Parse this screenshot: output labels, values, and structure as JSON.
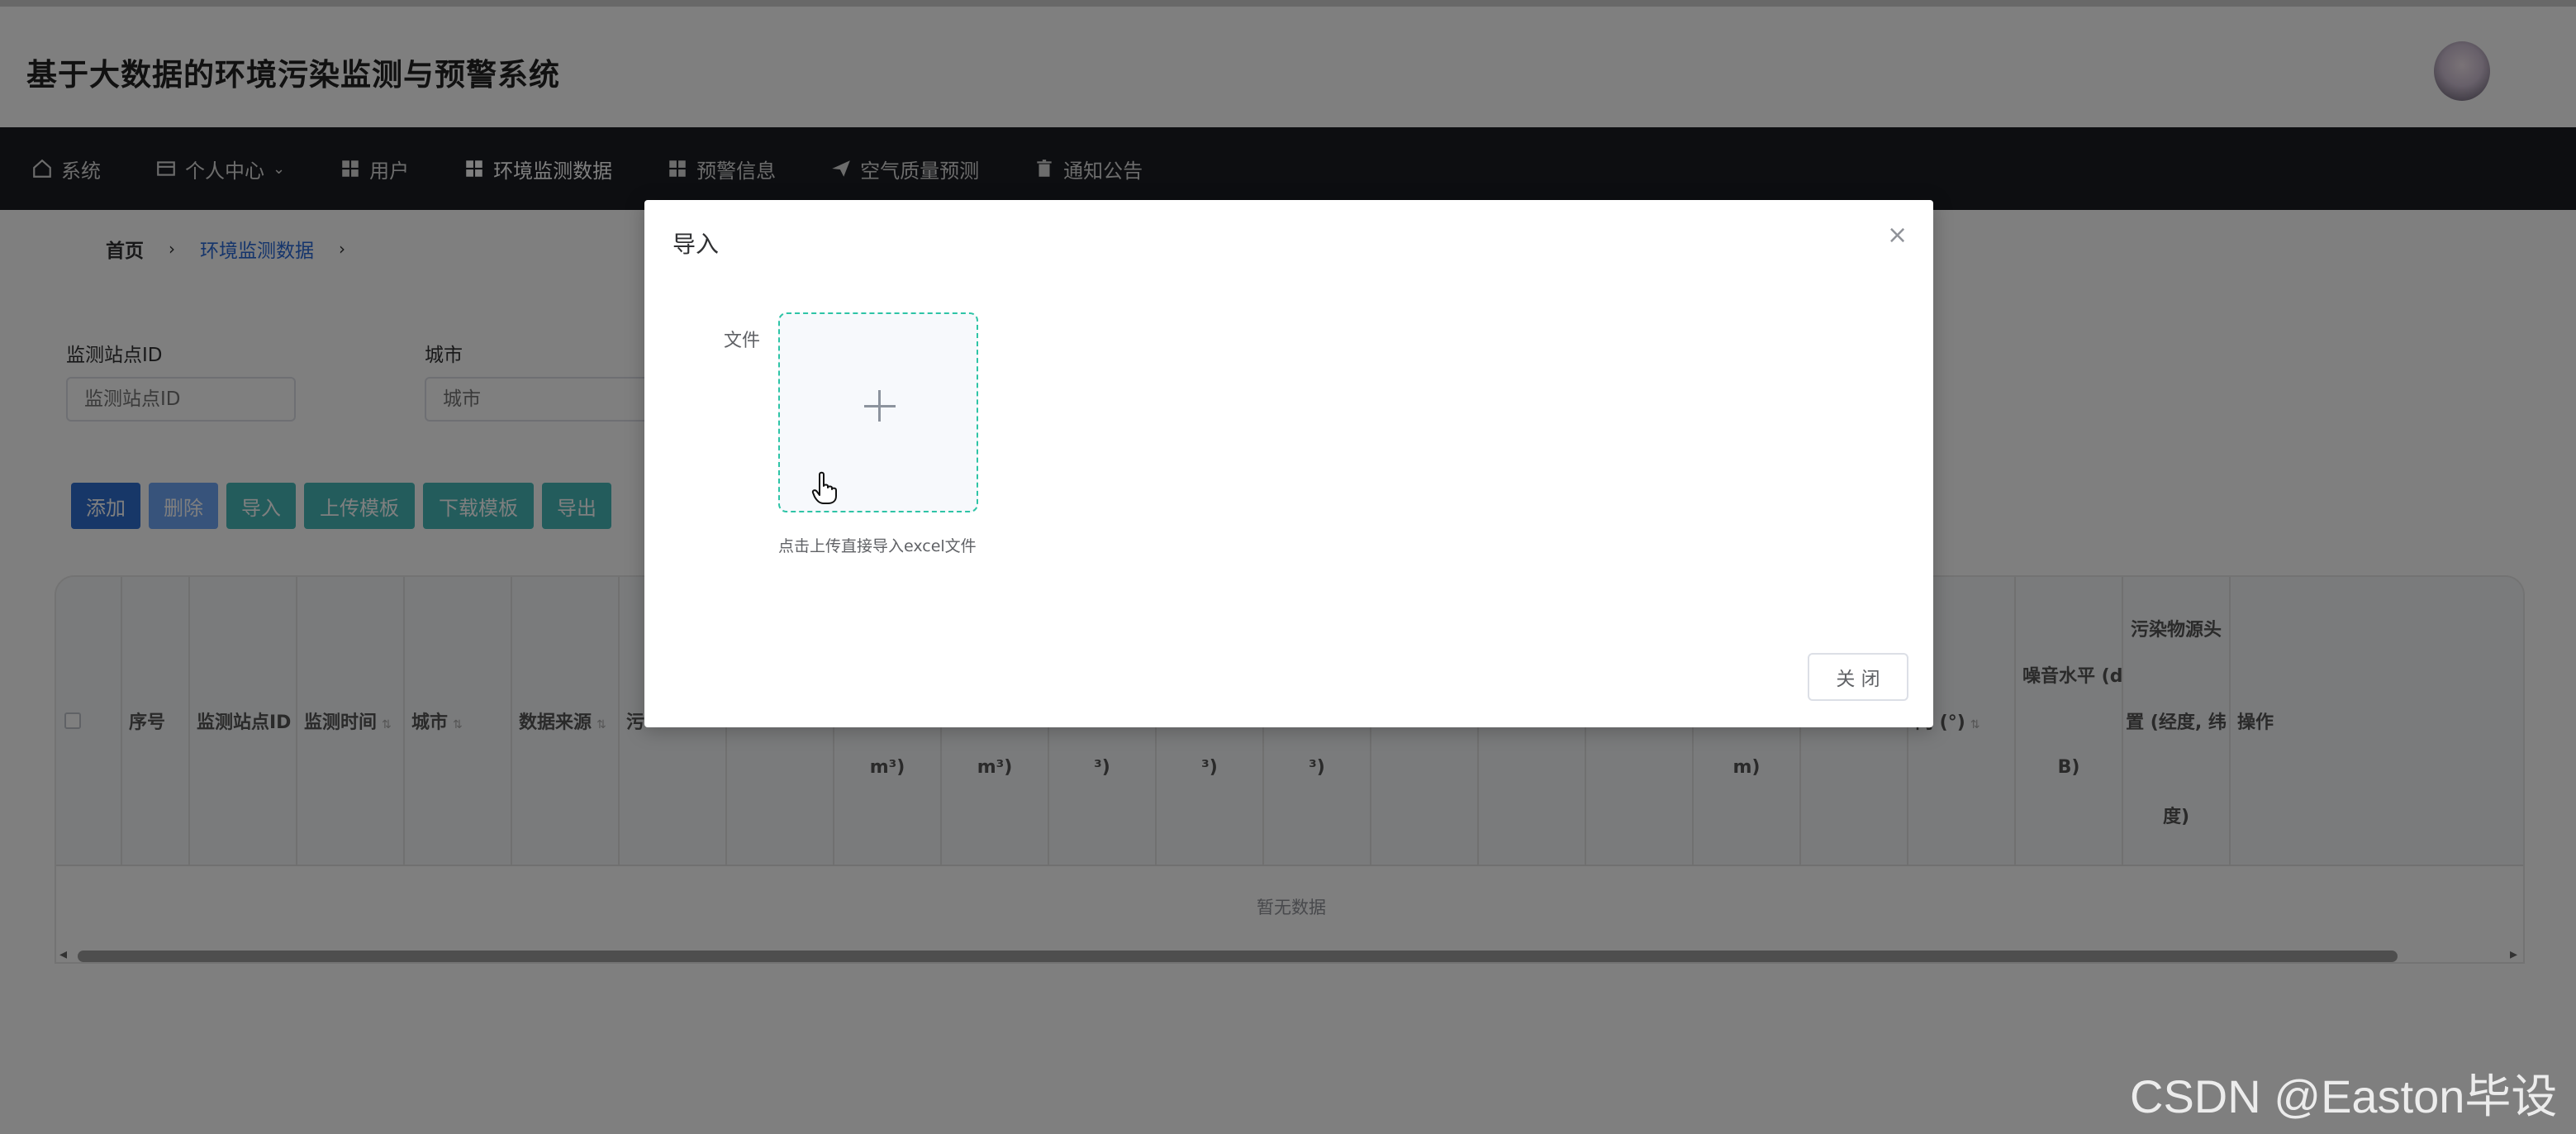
{
  "app": {
    "title": "基于大数据的环境污染监测与预警系统"
  },
  "nav": {
    "items": [
      {
        "label": "系统",
        "icon": "home-icon"
      },
      {
        "label": "个人中心",
        "icon": "card-icon",
        "caret": "⌄"
      },
      {
        "label": "用户",
        "icon": "grid-icon"
      },
      {
        "label": "环境监测数据",
        "icon": "grid-icon"
      },
      {
        "label": "预警信息",
        "icon": "grid-icon"
      },
      {
        "label": "空气质量预测",
        "icon": "paper-plane-icon"
      },
      {
        "label": "通知公告",
        "icon": "trash-icon"
      }
    ]
  },
  "breadcrumb": {
    "home": "首页",
    "current": "环境监测数据",
    "separator": "›"
  },
  "filters": {
    "station_id": {
      "label": "监测站点ID",
      "placeholder": "监测站点ID"
    },
    "city": {
      "label": "城市",
      "placeholder": "城市"
    }
  },
  "toolbar": {
    "add": "添加",
    "delete": "删除",
    "import": "导入",
    "upload_template": "上传模板",
    "download_template": "下载模板",
    "export": "导出"
  },
  "colors": {
    "add_btn": "#2e6fd0",
    "delete_btn": "#6fa6f7",
    "teal_btn": "#46b9b9",
    "upload_border": "#2ec4a6",
    "nav_bg": "#1b1d22"
  },
  "table": {
    "columns": {
      "seq": "序号",
      "station_id": "监测站点ID",
      "monitor_time": "监测时间",
      "city": "城市",
      "data_source": "数据来源",
      "col6": "污",
      "sub_m3_1": "m³)",
      "sub_m3_2": "m³)",
      "sub_3_1": "³)",
      "sub_3_2": "³)",
      "sub_3_3": "³)",
      "sub_m": "m)",
      "wind_dir": "向 (°)",
      "noise": "噪音水平 (d",
      "noise_unit": "B)",
      "pollution_src_1": "污染物源头",
      "pollution_src_2": "置 (经度, 纬",
      "pollution_src_3": "度)",
      "operation": "操作"
    },
    "empty_text": "暂无数据"
  },
  "dialog": {
    "title": "导入",
    "close_glyph": "×",
    "file_label": "文件",
    "upload_tip": "点击上传直接导入excel文件",
    "close_button": "关 闭"
  },
  "watermark": "CSDN @Easton毕设"
}
